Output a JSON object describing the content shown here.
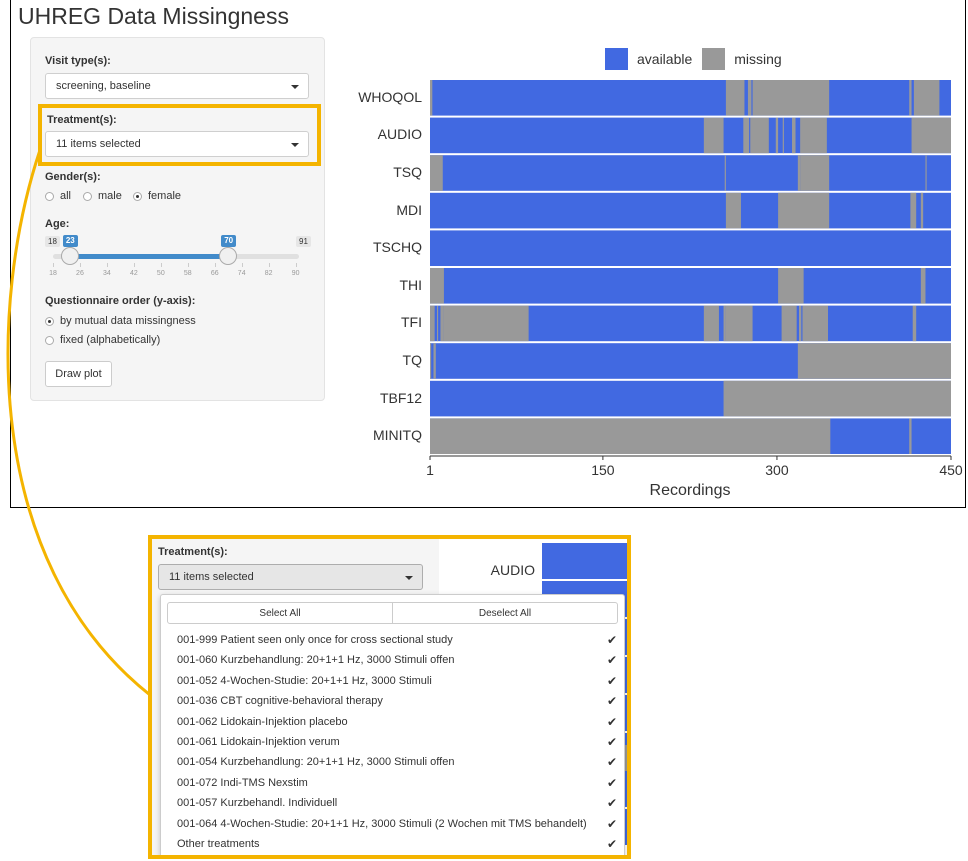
{
  "app": {
    "title": "UHREG Data Missingness"
  },
  "sidebar": {
    "visit_label": "Visit type(s):",
    "visit_value": "screening, baseline",
    "treatment_label": "Treatment(s):",
    "treatment_value": "11 items selected",
    "gender_label": "Gender(s):",
    "gender_options": [
      {
        "label": "all",
        "selected": false
      },
      {
        "label": "male",
        "selected": false
      },
      {
        "label": "female",
        "selected": true
      }
    ],
    "age_label": "Age:",
    "age_slider": {
      "min": 18,
      "max": 91,
      "low": 23,
      "high": 70,
      "min_label": "18",
      "max_label": "91",
      "low_label": "23",
      "high_label": "70",
      "ticks": [
        "18",
        "26",
        "34",
        "42",
        "50",
        "58",
        "66",
        "74",
        "82",
        "90"
      ],
      "tick_values": [
        18,
        26,
        34,
        42,
        50,
        58,
        66,
        74,
        82,
        90
      ]
    },
    "order_label": "Questionnaire order (y-axis):",
    "order_options": [
      {
        "label": "by mutual data missingness",
        "selected": true
      },
      {
        "label": "fixed (alphabetically)",
        "selected": false
      }
    ],
    "draw_button": "Draw plot"
  },
  "chart_data": {
    "type": "heatmap",
    "xlabel": "Recordings",
    "x_range": [
      1,
      450
    ],
    "x_ticks": [
      "1",
      "150",
      "300",
      "450"
    ],
    "x_tick_values": [
      1,
      150,
      300,
      450
    ],
    "legend": [
      {
        "name": "available",
        "color": "#4169e1"
      },
      {
        "name": "missing",
        "color": "#999999"
      }
    ],
    "rows": [
      {
        "name": "WHOQOL",
        "missing": [
          [
            1,
            3
          ],
          [
            256,
            272
          ],
          [
            275,
            278
          ],
          [
            279,
            345
          ],
          [
            414,
            416
          ],
          [
            418,
            440
          ]
        ]
      },
      {
        "name": "AUDIO",
        "missing": [
          [
            237,
            254
          ],
          [
            271,
            276
          ],
          [
            277,
            293
          ],
          [
            299,
            301
          ],
          [
            305,
            306
          ],
          [
            313,
            316
          ],
          [
            320,
            343
          ],
          [
            416,
            450
          ]
        ]
      },
      {
        "name": "TSQ",
        "missing": [
          [
            1,
            12
          ],
          [
            255,
            256
          ],
          [
            318,
            320
          ],
          [
            320,
            345
          ],
          [
            428,
            429
          ]
        ]
      },
      {
        "name": "MDI",
        "missing": [
          [
            256,
            269
          ],
          [
            301,
            345
          ],
          [
            415,
            420
          ],
          [
            424,
            426
          ]
        ]
      },
      {
        "name": "TSCHQ",
        "missing": []
      },
      {
        "name": "THI",
        "missing": [
          [
            1,
            13
          ],
          [
            301,
            323
          ],
          [
            424,
            428
          ]
        ]
      },
      {
        "name": "TFI",
        "missing": [
          [
            1,
            5
          ],
          [
            7,
            8
          ],
          [
            10,
            13
          ],
          [
            13,
            86
          ],
          [
            237,
            250
          ],
          [
            254,
            256
          ],
          [
            256,
            279
          ],
          [
            304,
            317
          ],
          [
            319,
            321
          ],
          [
            322,
            344
          ],
          [
            417,
            420
          ]
        ]
      },
      {
        "name": "TQ",
        "missing": [
          [
            1,
            2
          ],
          [
            4,
            6
          ],
          [
            318,
            450
          ]
        ]
      },
      {
        "name": "TBF12",
        "missing": [
          [
            254,
            450
          ]
        ]
      },
      {
        "name": "MINITQ",
        "missing": [
          [
            1,
            346
          ],
          [
            414,
            416
          ]
        ]
      }
    ]
  },
  "inset": {
    "treatment_label": "Treatment(s):",
    "treatment_value": "11 items selected",
    "chart_row_label": "AUDIO",
    "select_all": "Select All",
    "deselect_all": "Deselect All",
    "check_mark": "✔",
    "items": [
      "001-999 Patient seen only once for cross sectional study",
      "001-060 Kurzbehandlung: 20+1+1 Hz, 3000 Stimuli offen",
      "001-052 4-Wochen-Studie: 20+1+1 Hz, 3000 Stimuli",
      "001-036 CBT cognitive-behavioral therapy",
      "001-062 Lidokain-Injektion placebo",
      "001-061 Lidokain-Injektion verum",
      "001-054 Kurzbehandlung: 20+1+1 Hz, 3000 Stimuli offen",
      "001-072 Indi-TMS Nexstim",
      "001-057 Kurzbehandl. Individuell",
      "001-064 4-Wochen-Studie: 20+1+1 Hz, 3000 Stimuli (2 Wochen mit TMS behandelt)",
      "Other treatments"
    ]
  }
}
